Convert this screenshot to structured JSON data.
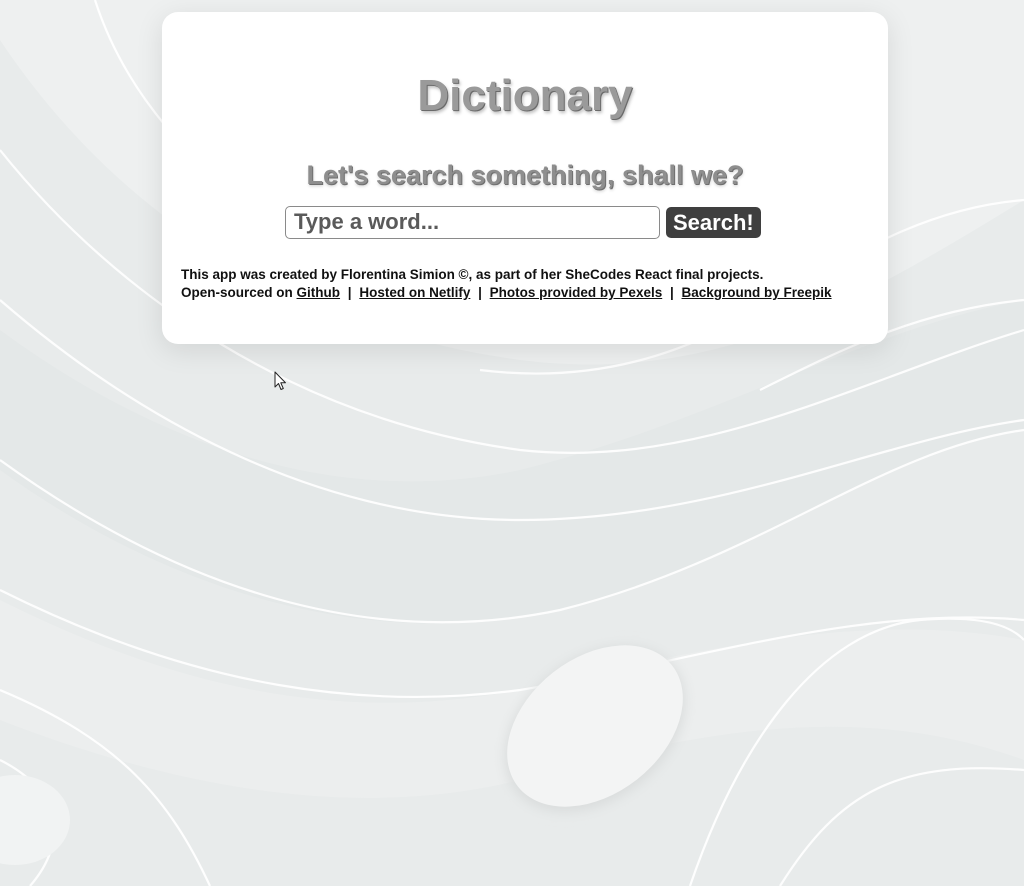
{
  "app": {
    "title": "Dictionary",
    "subtitle": "Let's search something, shall we?"
  },
  "search": {
    "placeholder": "Type a word...",
    "value": "",
    "button_label": "Search!"
  },
  "footer": {
    "credit": "This app was created by Florentina Simion ©, as part of her SheCodes React final projects.",
    "open_sourced_prefix": "Open-sourced on",
    "separator": "|",
    "links": [
      {
        "label": "Github"
      },
      {
        "label": "Hosted on Netlify"
      },
      {
        "label": "Photos provided by Pexels"
      },
      {
        "label": "Background by Freepik"
      }
    ]
  },
  "colors": {
    "background": "#e9ecec",
    "card": "#ffffff",
    "title": "#9a9a9a",
    "button": "#3f3f3f"
  },
  "icons": {
    "pointer": "mouse-cursor-icon"
  }
}
